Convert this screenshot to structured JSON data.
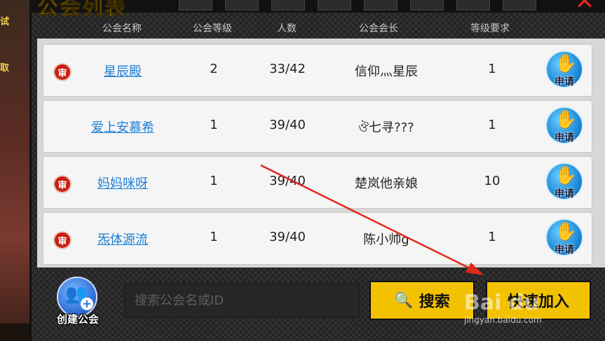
{
  "background": {
    "side_text_1": "试",
    "side_text_2": "取"
  },
  "window": {
    "title": "公会列表",
    "close_icon": "close-x-icon"
  },
  "table": {
    "headers": [
      "公会名称",
      "公会等级",
      "人数",
      "公会会长",
      "等级要求"
    ],
    "rows": [
      {
        "badge": "审",
        "name": "星辰殿",
        "level": "2",
        "members": "33/42",
        "leader": "信仰灬星辰",
        "req": "1",
        "apply_label": "申请"
      },
      {
        "badge": "",
        "name": "爱上安慕希",
        "level": "1",
        "members": "39/40",
        "leader": "ঔ七寻???",
        "req": "1",
        "apply_label": "申请"
      },
      {
        "badge": "审",
        "name": "妈妈咪呀",
        "level": "1",
        "members": "39/40",
        "leader": "楚岚他亲娘",
        "req": "10",
        "apply_label": "申请"
      },
      {
        "badge": "审",
        "name": "炁体源流",
        "level": "1",
        "members": "39/40",
        "leader": "陈小帅g",
        "req": "1",
        "apply_label": "申请"
      }
    ]
  },
  "bottom": {
    "create_label": "创建公会",
    "search_placeholder": "搜索公会名或ID",
    "search_label": "搜索",
    "quick_join_label": "快速加入"
  },
  "watermark": {
    "brand": "Bai du",
    "url": "jingyan.baidu.com"
  },
  "colors": {
    "accent_yellow": "#f2c200",
    "link_blue": "#1b7fd6",
    "badge_red": "#c81e14",
    "annotation_red": "#e0281c"
  }
}
